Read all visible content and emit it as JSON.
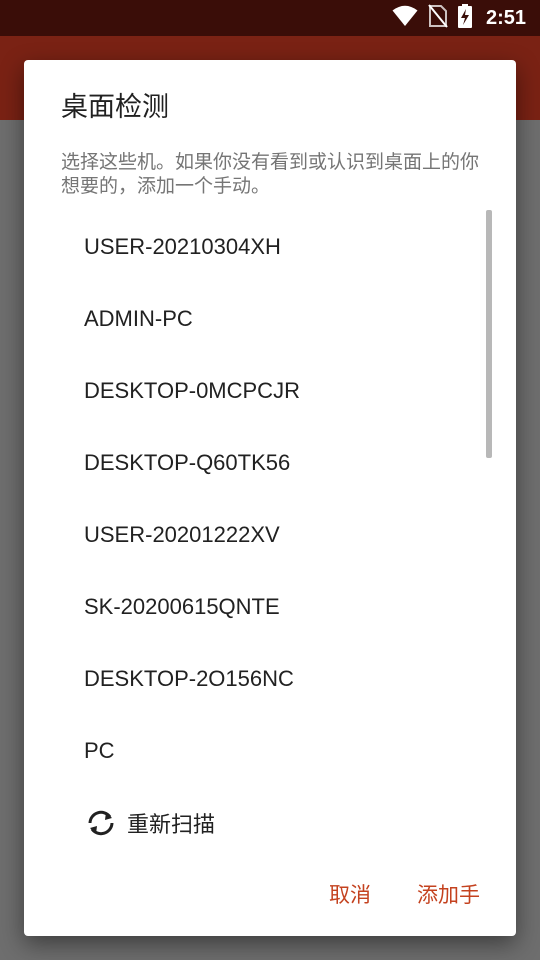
{
  "status_bar": {
    "time": "2:51",
    "icons": [
      "wifi-icon",
      "no-sim-icon",
      "battery-charging-icon"
    ]
  },
  "dialog": {
    "title": "桌面检测",
    "message": "选择这些机。如果你没有看到或认识到桌面上的你想要的，添加一个手动。",
    "items": [
      {
        "label": "USER-20210304XH"
      },
      {
        "label": "ADMIN-PC"
      },
      {
        "label": "DESKTOP-0MCPCJR"
      },
      {
        "label": "DESKTOP-Q60TK56"
      },
      {
        "label": "USER-20201222XV"
      },
      {
        "label": "SK-20200615QNTE"
      },
      {
        "label": "DESKTOP-2O156NC"
      },
      {
        "label": "PC"
      }
    ],
    "rescan_label": "重新扫描",
    "buttons": {
      "cancel": "取消",
      "add_manual": "添加手"
    }
  },
  "colors": {
    "status_bar": "#3a0d08",
    "app_bar": "#7a2214",
    "accent": "#c4421f",
    "backdrop": "#6e6e6e"
  }
}
